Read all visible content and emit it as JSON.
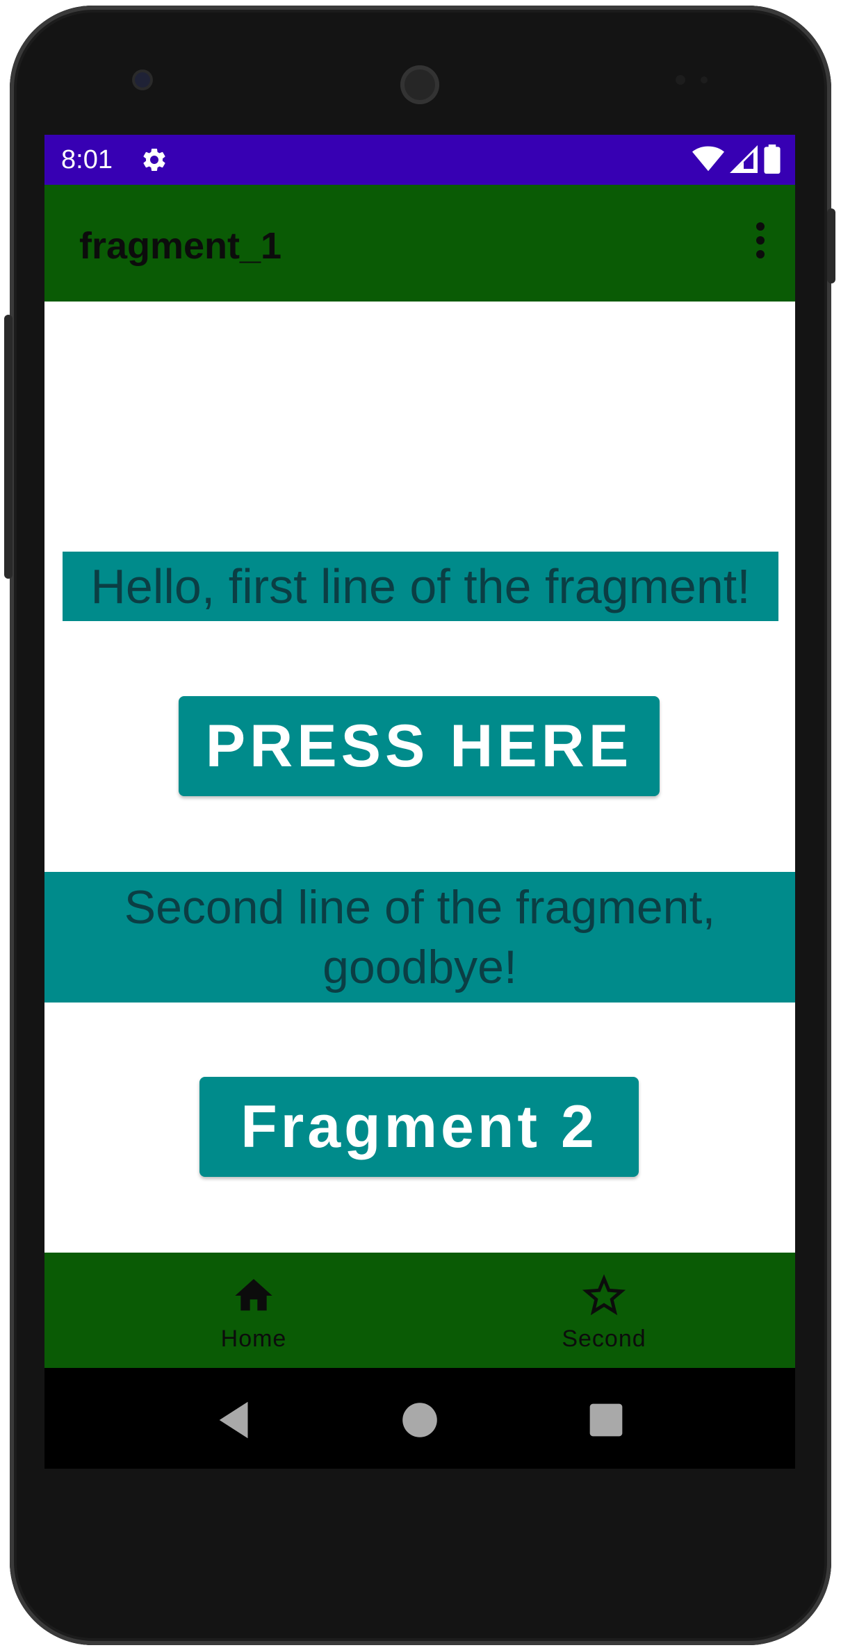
{
  "colors": {
    "status_bar": "#3700b3",
    "app_bar": "#0a5b05",
    "teal": "#008b8b",
    "teal_text": "#0b3e44",
    "bottom_nav": "#0a5b05",
    "system_nav": "#000000"
  },
  "status_bar": {
    "time": "8:01",
    "icons": [
      "gear-icon",
      "wifi-icon",
      "signal-icon",
      "battery-icon"
    ]
  },
  "app_bar": {
    "title": "fragment_1",
    "menu_icon": "more-vert-icon"
  },
  "content": {
    "first_line": "Hello, first line of the fragment!",
    "press_button": "PRESS HERE",
    "second_line": "Second line of the fragment, goodbye!",
    "fragment2_button": "Fragment 2"
  },
  "bottom_nav": {
    "items": [
      {
        "label": "Home",
        "icon": "home-icon"
      },
      {
        "label": "Second",
        "icon": "star-outline-icon"
      }
    ]
  },
  "system_nav": {
    "icons": [
      "back-icon",
      "home-circle-icon",
      "recents-icon"
    ]
  }
}
